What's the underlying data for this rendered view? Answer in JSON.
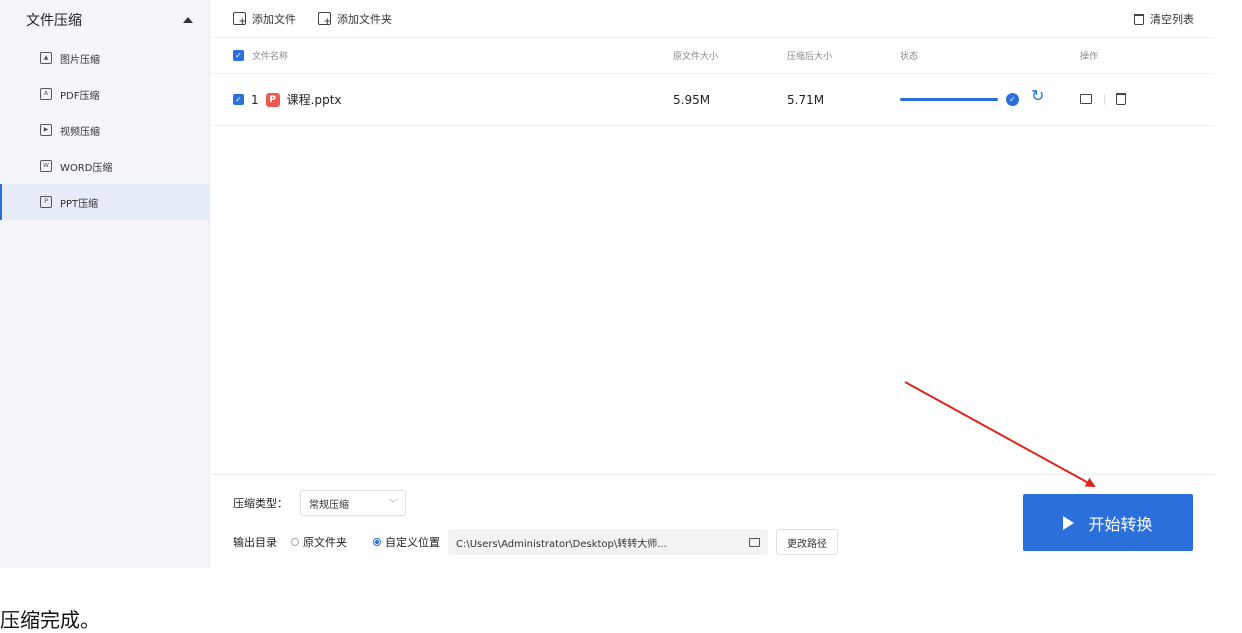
{
  "sidebar": {
    "title": "文件压缩",
    "items": [
      {
        "label": "图片压缩",
        "icon": "image-icon"
      },
      {
        "label": "PDF压缩",
        "icon": "pdf-icon"
      },
      {
        "label": "视频压缩",
        "icon": "video-icon"
      },
      {
        "label": "WORD压缩",
        "icon": "word-icon"
      },
      {
        "label": "PPT压缩",
        "icon": "ppt-icon",
        "active": true
      }
    ]
  },
  "toolbar": {
    "add_file": "添加文件",
    "add_folder": "添加文件夹",
    "clear_list": "清空列表"
  },
  "table": {
    "headers": {
      "name": "文件名称",
      "original_size": "原文件大小",
      "compressed_size": "压缩后大小",
      "status": "状态",
      "actions": "操作"
    },
    "rows": [
      {
        "index": "1",
        "badge": "P",
        "filename": "课程.pptx",
        "original_size": "5.95M",
        "compressed_size": "5.71M",
        "progress": 1.0
      }
    ]
  },
  "settings": {
    "compress_type_label": "压缩类型：",
    "compress_type_value": "常规压缩",
    "output_label": "输出目录",
    "option_original": "原文件夹",
    "option_custom": "自定义位置",
    "path": "C:\\Users\\Administrator\\Desktop\\转转大师...",
    "change_path": "更改路径"
  },
  "start_button": "开始转换",
  "caption": "压缩完成。",
  "colors": {
    "accent": "#2a6fdb",
    "ppt_badge": "#ec5a52",
    "arrow": "#e0231c"
  }
}
